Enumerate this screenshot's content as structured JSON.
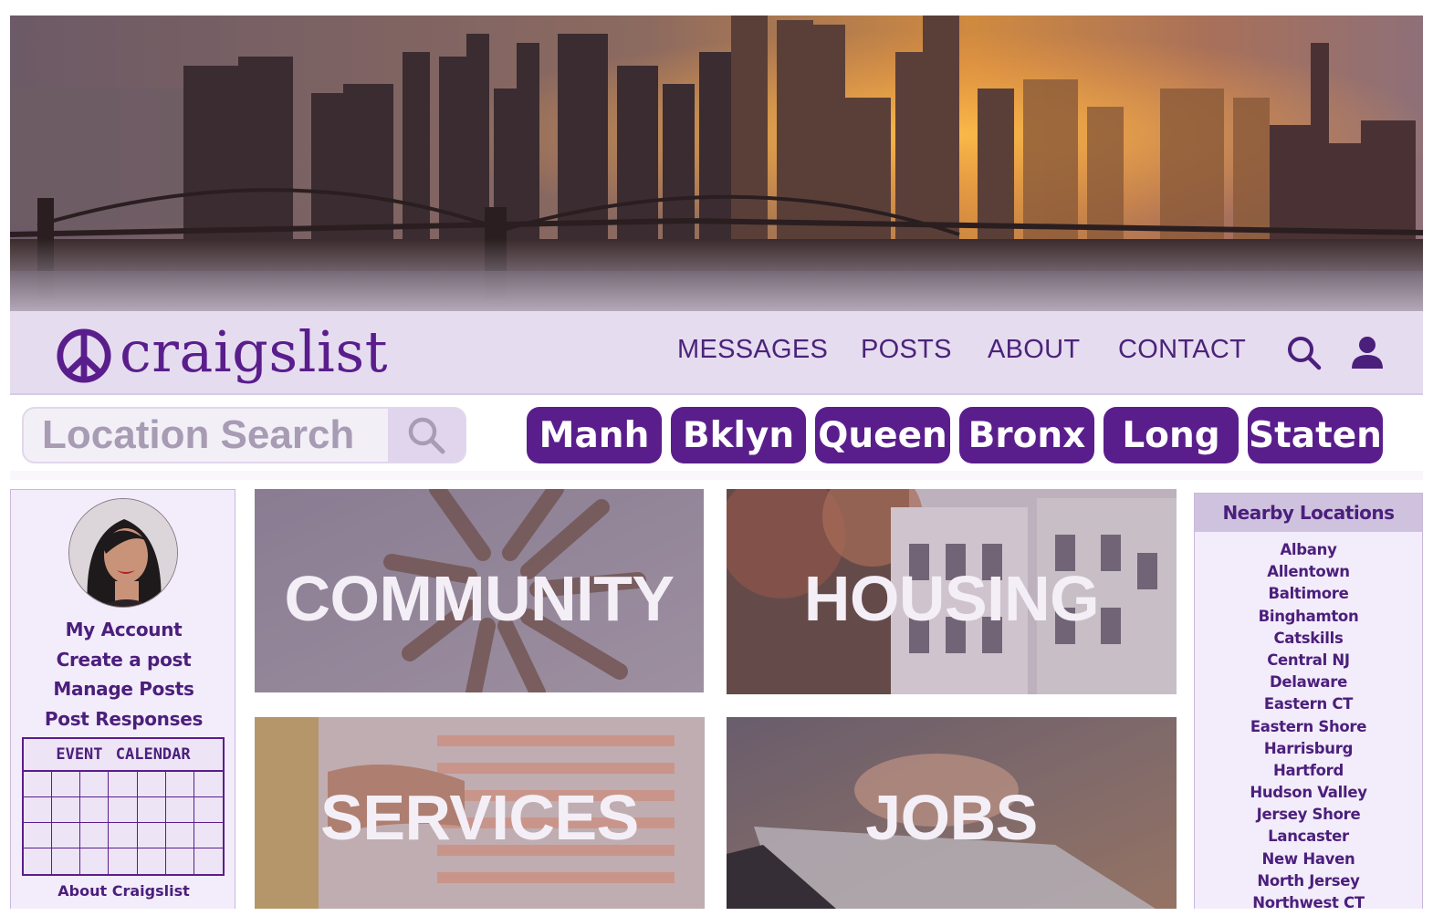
{
  "brand": {
    "name": "craigslist",
    "color": "#5a1e8c"
  },
  "nav": {
    "messages": "MESSAGES",
    "posts": "POSTS",
    "about": "ABOUT",
    "contact": "CONTACT"
  },
  "search": {
    "placeholder": "Location Search"
  },
  "boroughs": [
    "Manh",
    "Bklyn",
    "Queen",
    "Bronx",
    "Long",
    "Staten"
  ],
  "sidebar": {
    "links": [
      "My Account",
      "Create a post",
      "Manage Posts",
      "Post Responses"
    ],
    "calendar_title": "EVENT CALENDAR",
    "about": "About Craigslist"
  },
  "categories": {
    "community": "COMMUNITY",
    "housing": "HOUSING",
    "services": "SERVICES",
    "jobs": "JOBS"
  },
  "nearby": {
    "title": "Nearby Locations",
    "items": [
      "Albany",
      "Allentown",
      "Baltimore",
      "Binghamton",
      "Catskills",
      "Central NJ",
      "Delaware",
      "Eastern CT",
      "Eastern Shore",
      "Harrisburg",
      "Hartford",
      "Hudson Valley",
      "Jersey Shore",
      "Lancaster",
      "New Haven",
      "North Jersey",
      "Northwest CT"
    ]
  }
}
